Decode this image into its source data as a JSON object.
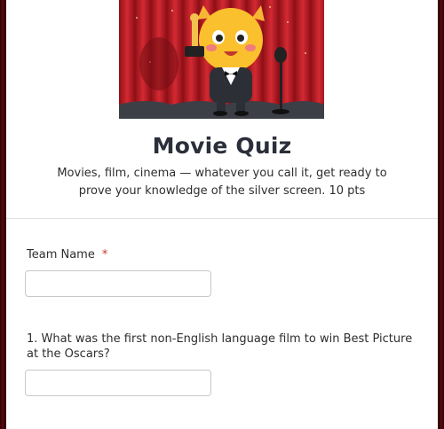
{
  "form": {
    "title": "Movie Quiz",
    "description": "Movies, film, cinema — whatever you call it, get ready to prove your knowledge of the silver screen. 10 pts",
    "header_image": "cat-holding-trophy-on-stage-illustration"
  },
  "fields": {
    "team_name": {
      "label": "Team Name",
      "required_mark": "*",
      "value": "",
      "placeholder": ""
    },
    "q1": {
      "label": "1.  What was the first non-English language film to win Best Picture at the Oscars?",
      "value": "",
      "placeholder": ""
    }
  },
  "colors": {
    "background": "#3a0407",
    "card": "#ffffff",
    "title": "#2b2f3a",
    "required": "#c0392b",
    "curtain": "#c21e28"
  }
}
